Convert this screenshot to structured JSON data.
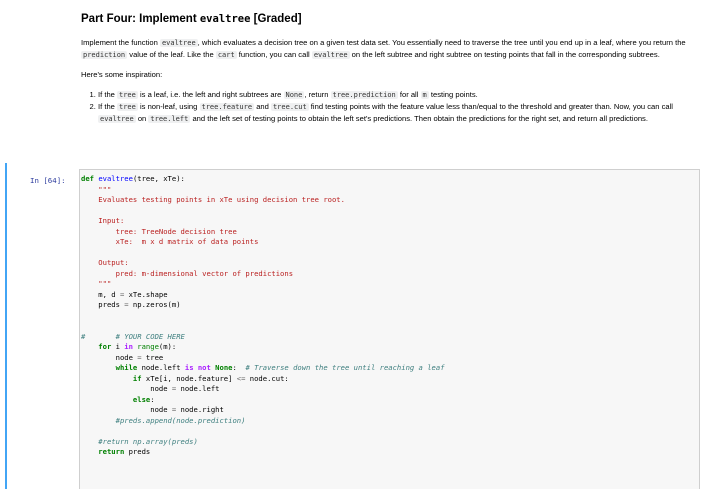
{
  "markdown": {
    "heading_prefix": "Part Four: Implement ",
    "heading_code": "evaltree",
    "heading_suffix": " [Graded]",
    "intro": [
      {
        "t": "Implement the function "
      },
      {
        "c": "evaltree"
      },
      {
        "t": ", which evaluates a decision tree on a given test data set. You essentially need to traverse the tree until you end up in a leaf, where you return the "
      },
      {
        "c": "prediction"
      },
      {
        "t": " value of the leaf. Like the "
      },
      {
        "c": "cart"
      },
      {
        "t": " function, you can call "
      },
      {
        "c": "evaltree"
      },
      {
        "t": " on the left subtree and right subtree on testing points that fall in the corresponding subtrees."
      }
    ],
    "inspiration": "Here's some inspiration:",
    "steps": [
      [
        {
          "t": "If the "
        },
        {
          "c": "tree"
        },
        {
          "t": " is a leaf, i.e. the left and right subtrees are "
        },
        {
          "c": "None"
        },
        {
          "t": ", return "
        },
        {
          "c": "tree.prediction"
        },
        {
          "t": " for all "
        },
        {
          "c": "m"
        },
        {
          "t": " testing points."
        }
      ],
      [
        {
          "t": "If the "
        },
        {
          "c": "tree"
        },
        {
          "t": " is non-leaf, using "
        },
        {
          "c": "tree.feature"
        },
        {
          "t": " and "
        },
        {
          "c": "tree.cut"
        },
        {
          "t": " find testing points with the feature value less than/equal to the threshold and greater than. Now, you can call "
        },
        {
          "c": "evaltree"
        },
        {
          "t": " on "
        },
        {
          "c": "tree.left"
        },
        {
          "t": " and the left set of testing points to obtain the left set's predictions. Then obtain the predictions for the right set, and return all predictions."
        }
      ]
    ]
  },
  "cell": {
    "prompt": "In [64]:",
    "code_lines": [
      [
        [
          "kw",
          "def "
        ],
        [
          "fn",
          "evaltree"
        ],
        [
          "",
          "(tree, xTe):"
        ]
      ],
      [
        [
          "st",
          "    \"\"\""
        ]
      ],
      [
        [
          "st",
          "    Evaluates testing points in xTe using decision tree root."
        ]
      ],
      [
        [
          "",
          ""
        ]
      ],
      [
        [
          "st",
          "    Input:"
        ]
      ],
      [
        [
          "st",
          "        tree: TreeNode decision tree"
        ]
      ],
      [
        [
          "st",
          "        xTe:  m x d matrix of data points"
        ]
      ],
      [
        [
          "",
          ""
        ]
      ],
      [
        [
          "st",
          "    Output:"
        ]
      ],
      [
        [
          "st",
          "        pred: m-dimensional vector of predictions"
        ]
      ],
      [
        [
          "st",
          "    \"\"\""
        ]
      ],
      [
        [
          "",
          "    m, d "
        ],
        [
          "o",
          "="
        ],
        [
          "",
          " xTe.shape"
        ]
      ],
      [
        [
          "",
          "    preds "
        ],
        [
          "o",
          "="
        ],
        [
          "",
          " np.zeros(m)"
        ]
      ],
      [
        [
          "",
          ""
        ]
      ],
      [
        [
          "",
          ""
        ]
      ],
      [
        [
          "cm",
          "#       # YOUR CODE HERE"
        ]
      ],
      [
        [
          "kw",
          "    for "
        ],
        [
          "",
          "i "
        ],
        [
          "op",
          "in "
        ],
        [
          "bi",
          "range"
        ],
        [
          "",
          "(m):"
        ]
      ],
      [
        [
          "",
          "        node "
        ],
        [
          "o",
          "="
        ],
        [
          "",
          " tree"
        ]
      ],
      [
        [
          "kw",
          "        while "
        ],
        [
          "",
          "node.left "
        ],
        [
          "op",
          "is not "
        ],
        [
          "kw",
          "None"
        ],
        [
          "",
          ":  "
        ],
        [
          "cm",
          "# Traverse down the tree until reaching a leaf"
        ]
      ],
      [
        [
          "kw",
          "            if "
        ],
        [
          "",
          "xTe[i, node.feature] "
        ],
        [
          "o",
          "<="
        ],
        [
          "",
          " node.cut:"
        ]
      ],
      [
        [
          "",
          "                node "
        ],
        [
          "o",
          "="
        ],
        [
          "",
          " node.left"
        ]
      ],
      [
        [
          "kw",
          "            else"
        ],
        [
          "",
          ":"
        ]
      ],
      [
        [
          "",
          "                node "
        ],
        [
          "o",
          "="
        ],
        [
          "",
          " node.right"
        ]
      ],
      [
        [
          "cm",
          "        #preds.append(node.prediction)"
        ]
      ],
      [
        [
          "",
          ""
        ]
      ],
      [
        [
          "cm",
          "    #return np.array(preds)"
        ]
      ],
      [
        [
          "kw",
          "    return "
        ],
        [
          "",
          "preds"
        ]
      ]
    ]
  }
}
